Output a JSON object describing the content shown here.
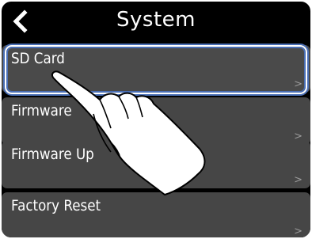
{
  "header": {
    "title": "System",
    "back_icon": "chevron-left-icon"
  },
  "menu": {
    "items": [
      {
        "label": "SD Card",
        "arrow": ">"
      },
      {
        "label": "Firmware",
        "arrow": ">"
      },
      {
        "label": "Firmware Up",
        "arrow": ">"
      },
      {
        "label": "Factory Reset",
        "arrow": ">"
      }
    ]
  },
  "colors": {
    "background": "#000000",
    "item_background": "#464646",
    "highlight_outline": "#4a6fb5",
    "text": "#ffffff"
  }
}
